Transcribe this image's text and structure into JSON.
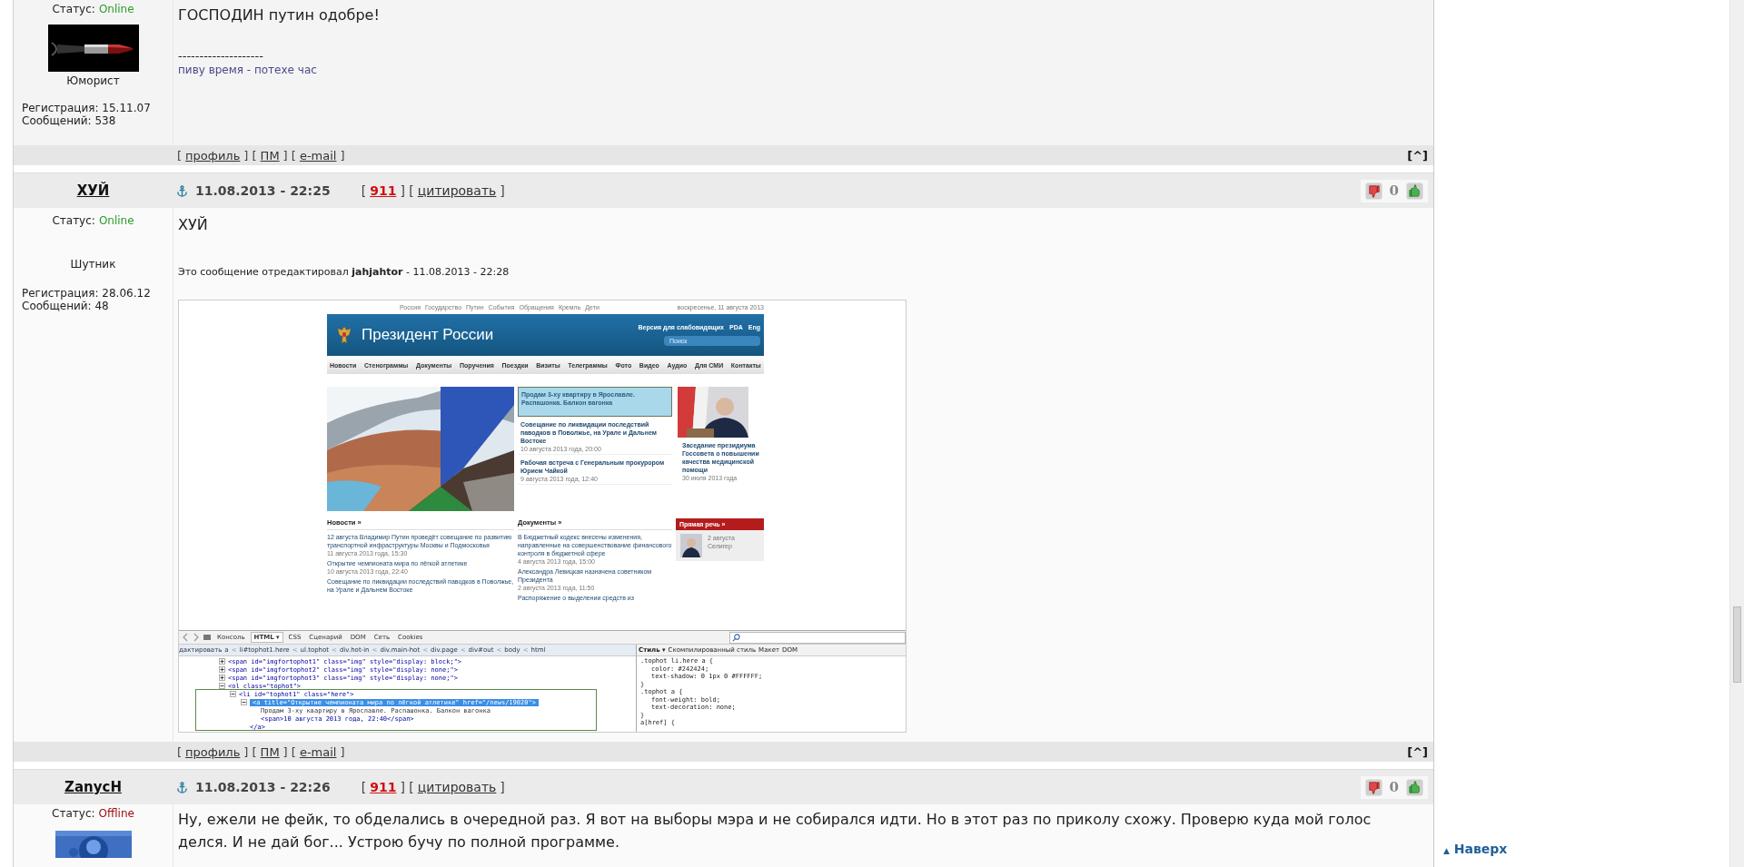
{
  "posts": [
    {
      "status_label": "Статус:",
      "status": "Online",
      "online": true,
      "rank": "Юморист",
      "registered": "Регистрация: 15.11.07",
      "messages": "Сообщений: 538",
      "text": "ГОСПОДИН путин одобре!",
      "separator": "--------------------",
      "signature": "пиву время - потехе час",
      "footer": {
        "open": "[",
        "sep": "] [",
        "close": "]",
        "links": [
          "профиль",
          "ПМ",
          "e-mail"
        ],
        "to_top": "[^]"
      }
    },
    {
      "author": "ХУЙ",
      "date": "11.08.2013 - 22:25",
      "open": "[",
      "rating": "911",
      "sep": "] [",
      "quote": "цитировать",
      "close": "]",
      "votes": "0",
      "status_label": "Статус:",
      "status": "Online",
      "online": true,
      "rank": "Шутник",
      "registered": "Регистрация: 28.06.12",
      "messages": "Сообщений: 48",
      "text": "ХУЙ",
      "edit_note": "Это сообщение отредактировал **jahjahtor** - 11.08.2013 - 22:28",
      "attachment": {
        "topnav": [
          "Россия",
          "Государство",
          "Путин",
          "События",
          "Обращения",
          "Кремль",
          "Дети"
        ],
        "today": "воскресенье, 11 августа 2013",
        "site_title": "Президент России",
        "header_links": [
          "Версия для слабовидящих",
          "PDA",
          "Eng"
        ],
        "search_placeholder": "Поиск",
        "nav": [
          "Новости",
          "Стенограммы",
          "Документы",
          "Поручения",
          "Поездки",
          "Визиты",
          "Телеграммы",
          "Фото",
          "Видео",
          "Аудио",
          "Для СМИ",
          "Контакты"
        ],
        "highlight": "Продам 3-ху квартиру в Ярославле. Распашонка. Балкон вагонка",
        "featured": [
          {
            "title": "Совещание по ликвидации последствий паводков в Поволжье, на Урале и Дальнем Востоке",
            "date": "10 августа 2013 года, 20:00"
          },
          {
            "title": "Рабочая встреча с Генеральным прокурором Юрием Чайкой",
            "date": "9 августа 2013 года, 12:40"
          }
        ],
        "side_feature": {
          "title": "Заседание президиума Госсовета о повышении качества медицинской помощи",
          "date": "30 июля 2013 года"
        },
        "columns": [
          {
            "heading": "Новости »",
            "items": [
              {
                "title": "12 августа Владимир Путин проведёт совещание по развитию транспортной инфраструктуры Москвы и Подмосковья",
                "date": "11 августа 2013 года, 15:30"
              },
              {
                "title": "Открытие чемпионата мира по лёгкой атлетике",
                "date": "10 августа 2013 года, 22:40"
              },
              {
                "title": "Совещание по ликвидации последствий паводков в Поволжье, на Урале и Дальнем Востоке"
              }
            ]
          },
          {
            "heading": "Документы »",
            "items": [
              {
                "title": "В Бюджетный кодекс внесены изменения, направленные на совершенствование финансового контроля в бюджетной сфере",
                "date": "4 августа 2013 года, 15:00"
              },
              {
                "title": "Александра Левицкая назначена советником Президента",
                "date": "2 августа 2013 года, 11:50"
              },
              {
                "title": "Распоряжение о выделении средств из"
              }
            ]
          }
        ],
        "speech": {
          "heading": "Прямая речь »",
          "date": "2 августа",
          "place": "Селигер"
        },
        "devtools": {
          "tabs": [
            {
              "label": "Консоль",
              "selected": false
            },
            {
              "label": "HTML ▾",
              "selected": true
            },
            {
              "label": "CSS",
              "selected": false
            },
            {
              "label": "Сценарий",
              "selected": false
            },
            {
              "label": "DOM",
              "selected": false
            },
            {
              "label": "Сеть",
              "selected": false
            },
            {
              "label": "Cookies",
              "selected": false
            }
          ],
          "edit": "дактировать",
          "sep": "<",
          "breadcrumb": [
            "a",
            "li#tophot1.here",
            "ul.tophot",
            "div.hot-in",
            "div.main-hot",
            "div.page",
            "div#out",
            "body",
            "html"
          ],
          "code": [
            {
              "text": "<span id=\"imgfortophot1\" class=\"img\" style=\"display: block;\">",
              "expanded": false,
              "selected": false
            },
            {
              "text": "<span id=\"imgfortophot2\" class=\"img\" style=\"display: none;\">",
              "expanded": false,
              "selected": false
            },
            {
              "text": "<span id=\"imgfortophot3\" class=\"img\" style=\"display: none;\">",
              "expanded": false,
              "selected": false
            },
            {
              "text": "<ol class=\"tophot\">",
              "expanded": true,
              "selected": false,
              "children": [
                {
                  "text": "<li id=\"tophot1\" class=\"here\">",
                  "expanded": true,
                  "selected": false,
                  "children": [
                    {
                      "text": "<a title=\"Открытие чемпионата мира по лёгкой атлетике\" href=\"/news/19020\">",
                      "expanded": true,
                      "selected": true,
                      "children": [
                        {
                          "text": "Продам 3-ху квартиру в Ярославле. Распашонка. Балкон вагонка",
                          "selected": false
                        },
                        {
                          "text": "<span>10 августа 2013 года, 22:40</span>",
                          "selected": false
                        }
                      ]
                    },
                    {
                      "text": "</a>",
                      "selected": false
                    }
                  ]
                }
              ]
            }
          ],
          "style_tabs": [
            {
              "label": "Стиль ▾",
              "selected": true
            },
            {
              "label": "Скомпилированный стиль",
              "selected": false
            },
            {
              "label": "Макет",
              "selected": false
            },
            {
              "label": "DOM",
              "selected": false
            }
          ],
          "css": [
            {
              "selector": ".tophot li.here a {",
              "props": [
                "color: #242424;",
                "text-shadow: 0 1px 0 #FFFFFF;"
              ],
              "close": "}"
            },
            {
              "selector": ".tophot a {",
              "props": [
                "font-weight: bold;",
                "text-decoration: none;"
              ],
              "close": "}"
            },
            {
              "selector": "a[href] {"
            }
          ]
        }
      },
      "footer": {
        "open": "[",
        "sep": "] [",
        "close": "]",
        "links": [
          "профиль",
          "ПМ",
          "e-mail"
        ],
        "to_top": "[^]"
      }
    },
    {
      "author": "ZanycH",
      "date": "11.08.2013 - 22:26",
      "open": "[",
      "rating": "911",
      "sep": "] [",
      "quote": "цитировать",
      "close": "]",
      "votes": "0",
      "status_label": "Статус:",
      "status": "Offline",
      "online": false,
      "text": "Ну, ежели не фейк, то обделались в очередной раз. Я вот на выборы мэра и не собирался идти. Но в этот раз по приколу схожу. Проверю куда мой голос делся. И не дай бог... Устрою бучу по полной программе."
    }
  ],
  "to_top": {
    "arrow": "▲",
    "label": "Наверх"
  }
}
